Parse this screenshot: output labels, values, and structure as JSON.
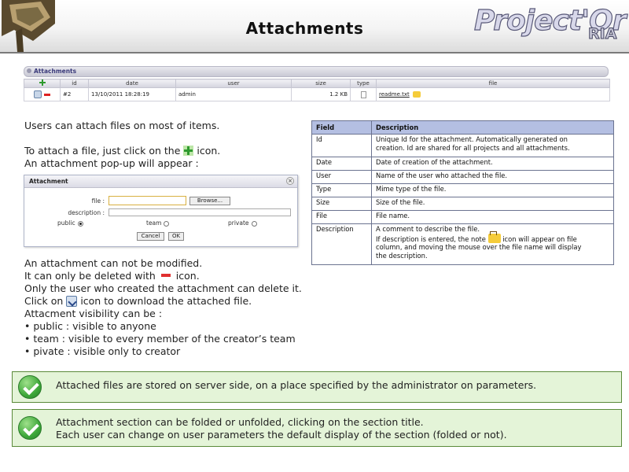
{
  "header": {
    "title": "Attachments",
    "brand": "Project'Or",
    "brand_sub": "RIA"
  },
  "attachments_section": {
    "title": "Attachments",
    "columns": [
      "id",
      "date",
      "user",
      "size",
      "type",
      "file"
    ],
    "rows": [
      {
        "id": "#2",
        "date": "13/10/2011 18:28:19",
        "user": "admin",
        "size": "1.2 KB",
        "file": "readme.txt"
      }
    ]
  },
  "intro": {
    "line1": "Users can attach files on most of items.",
    "line2_before": "To attach a file, just click on the",
    "line2_after": "icon.",
    "line3": "An attachment pop-up will appear :"
  },
  "dialog": {
    "title": "Attachment",
    "file_label": "file :",
    "browse_label": "Browse...",
    "description_label": "description :",
    "radio_options": [
      "public",
      "team",
      "private"
    ],
    "selected": "public",
    "cancel_label": "Cancel",
    "ok_label": "OK"
  },
  "body_text": {
    "not_modified": "An attachment can not be modified.",
    "delete_before": "It can only be deleted with",
    "delete_after": "icon.",
    "only_creator": "Only the user who created the attachment can delete it.",
    "download_before": "Click on",
    "download_after": "icon to download the attached file.",
    "visibility_intro": "Attacment visibility can be :",
    "bullets": [
      "• public : visible to anyone",
      "• team  : visible to every member of the creator’s team",
      "• pivate : visible only to creator"
    ]
  },
  "field_table": {
    "headers": [
      "Field",
      "Description"
    ],
    "rows": [
      {
        "field": "Id",
        "lines": [
          "Unique Id for the attachment. Automatically generated on",
          "creation. Id are shared for all projects and all attachments."
        ]
      },
      {
        "field": "Date",
        "lines": [
          "Date of creation of the attachment."
        ]
      },
      {
        "field": "User",
        "lines": [
          "Name of the user who attached the file."
        ]
      },
      {
        "field": "Type",
        "lines": [
          "Mime type of the file."
        ]
      },
      {
        "field": "Size",
        "lines": [
          "Size of the file."
        ]
      },
      {
        "field": "File",
        "lines": [
          "File name."
        ]
      }
    ],
    "description_row": {
      "field": "Description",
      "line1": "A comment to describe the file.",
      "line2_before": "If description is entered, the note",
      "line2_after": "icon will appear on file",
      "line3": "column, and moving the mouse over the file name will display",
      "line4": "the description."
    }
  },
  "info_boxes": [
    {
      "lines": [
        "Attached files are stored on server side, on a place specified by the administrator on parameters."
      ]
    },
    {
      "lines": [
        "Attachment section can be folded or unfolded, clicking on the section title.",
        "Each user can change on user parameters the default display of the section (folded or not)."
      ]
    }
  ],
  "colors": {
    "table_header": "#b4bfe2",
    "info_background": "#e4f4d8",
    "info_border": "#5a8a3a",
    "add_icon": "#2e9a2e",
    "delete_icon": "#e03030"
  }
}
